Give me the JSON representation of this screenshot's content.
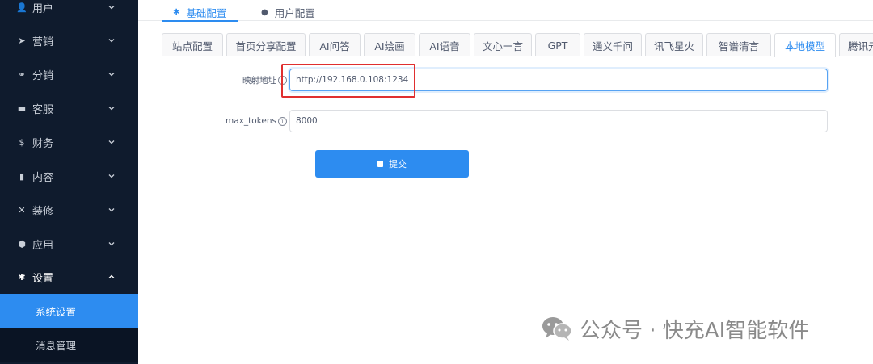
{
  "sidebar": {
    "items": [
      {
        "icon": "user-icon",
        "glyph": "👤",
        "label": "用户"
      },
      {
        "icon": "send-icon",
        "glyph": "➤",
        "label": "营销"
      },
      {
        "icon": "share-icon",
        "glyph": "⚭",
        "label": "分销"
      },
      {
        "icon": "chat-icon",
        "glyph": "▬",
        "label": "客服"
      },
      {
        "icon": "dollar-icon",
        "glyph": "$",
        "label": "财务"
      },
      {
        "icon": "book-icon",
        "glyph": "▮",
        "label": "内容"
      },
      {
        "icon": "tools-icon",
        "glyph": "✕",
        "label": "装修"
      },
      {
        "icon": "cube-icon",
        "glyph": "⬢",
        "label": "应用"
      },
      {
        "icon": "gear-icon",
        "glyph": "✱",
        "label": "设置"
      }
    ],
    "subitems": [
      {
        "label": "系统设置"
      },
      {
        "label": "消息管理"
      }
    ]
  },
  "top_tabs": [
    {
      "icon": "gear-icon",
      "glyph": "✱",
      "label": "基础配置"
    },
    {
      "icon": "user-circle-icon",
      "glyph": "●",
      "label": "用户配置"
    }
  ],
  "card_tabs": [
    "站点配置",
    "首页分享配置",
    "AI问答",
    "AI绘画",
    "AI语音",
    "文心一言",
    "GPT",
    "通义千问",
    "讯飞星火",
    "智谱清言",
    "本地模型",
    "腾讯元"
  ],
  "form": {
    "mapping_label": "映射地址",
    "mapping_value": "http://192.168.0.108:1234",
    "tokens_label": "max_tokens",
    "tokens_value": "8000",
    "info_glyph": "i",
    "submit_label": "提交"
  },
  "watermark": {
    "text": "公众号 · 快充AI智能软件"
  },
  "colors": {
    "sidebar_bg": "#0f1b2d",
    "accent": "#2d8cf0",
    "highlight_box": "#e02f2f"
  }
}
